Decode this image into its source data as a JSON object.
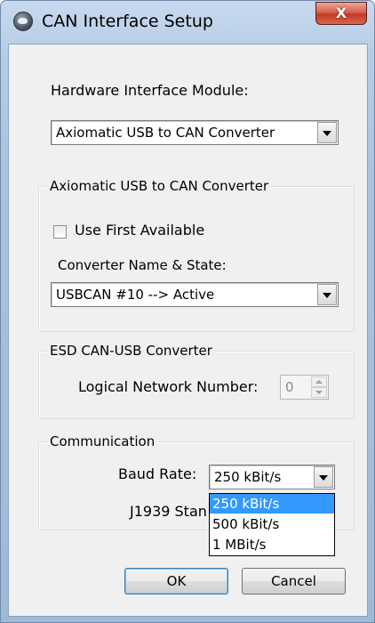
{
  "window": {
    "title": "CAN Interface Setup",
    "close_glyph": "X"
  },
  "hardware": {
    "label": "Hardware Interface Module:",
    "selected": "Axiomatic USB to CAN Converter"
  },
  "axiomatic_group": {
    "title": "Axiomatic USB to CAN Converter",
    "use_first_label": "Use First Available",
    "use_first_checked": false,
    "converter_label": "Converter Name & State:",
    "converter_selected": "USBCAN #10  --> Active"
  },
  "esd_group": {
    "title": "ESD CAN-USB Converter",
    "network_label": "Logical Network Number:",
    "network_value": "0"
  },
  "communication": {
    "title": "Communication",
    "baud_label": "Baud Rate:",
    "baud_selected": "250 kBit/s",
    "baud_options": [
      "250 kBit/s",
      "500 kBit/s",
      "1 MBit/s"
    ],
    "j1939_label": "J1939 Stan"
  },
  "buttons": {
    "ok": "OK",
    "cancel": "Cancel"
  },
  "colors": {
    "highlight": "#3399ff",
    "close_button": "#c23b22"
  }
}
